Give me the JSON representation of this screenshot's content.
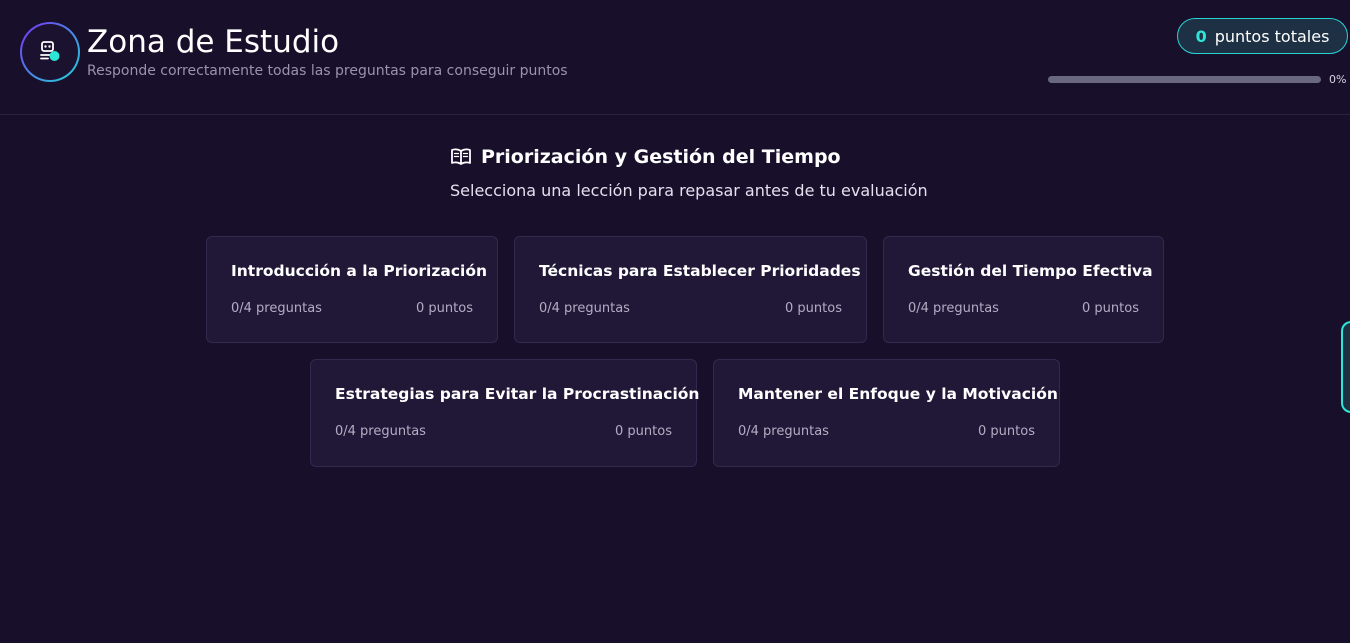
{
  "header": {
    "title": "Zona de Estudio",
    "subtitle": "Responde correctamente todas las preguntas para conseguir puntos",
    "logo_icon": "robot-icon",
    "points": {
      "value": "0",
      "label": "puntos totales"
    },
    "progress": {
      "percent": 0,
      "text": "0%"
    }
  },
  "section": {
    "icon": "open-book-icon",
    "title": "Priorización y Gestión del Tiempo",
    "subtitle": "Selecciona una lección para repasar antes de tu evaluación"
  },
  "lessons": [
    {
      "title": "Introducción a la Priorización",
      "questions": "0/4 preguntas",
      "points": "0 puntos"
    },
    {
      "title": "Técnicas para Establecer Prioridades",
      "questions": "0/4 preguntas",
      "points": "0 puntos"
    },
    {
      "title": "Gestión del Tiempo Efectiva",
      "questions": "0/4 preguntas",
      "points": "0 puntos"
    },
    {
      "title": "Estrategias para Evitar la Procrastinación",
      "questions": "0/4 preguntas",
      "points": "0 puntos"
    },
    {
      "title": "Mantener el Enfoque y la Motivación",
      "questions": "0/4 preguntas",
      "points": "0 puntos"
    }
  ],
  "colors": {
    "background": "#180f2b",
    "card": "#211838",
    "accent": "#2ee6d6",
    "brand_purple": "#7b2ff7"
  }
}
